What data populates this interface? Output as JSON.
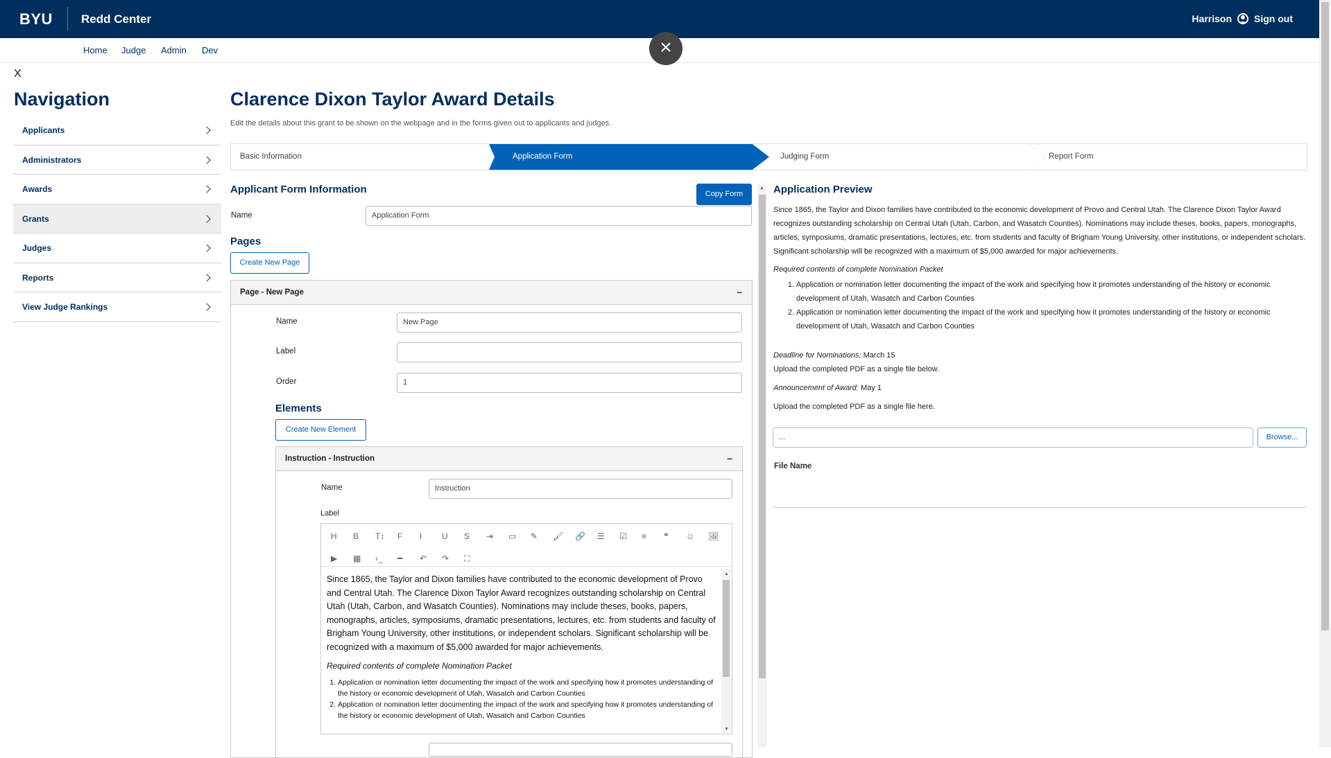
{
  "header": {
    "logo": "BYU",
    "site": "Redd Center",
    "user": "Harrison",
    "signout": "Sign out"
  },
  "subnav": [
    "Home",
    "Judge",
    "Admin",
    "Dev"
  ],
  "overlay_close": "×",
  "sidebar": {
    "close": "X",
    "title": "Navigation",
    "items": [
      "Applicants",
      "Administrators",
      "Awards",
      "Grants",
      "Judges",
      "Reports",
      "View Judge Rankings"
    ]
  },
  "page": {
    "title": "Clarence Dixon Taylor Award Details",
    "subtitle": "Edit the details about this grant to be shown on the webpage and in the forms given out to applicants and judges."
  },
  "steps": [
    "Basic Information",
    "Application Form",
    "Judging Form",
    "Report Form"
  ],
  "form": {
    "heading": "Applicant Form Information",
    "copy_button": "Copy Form",
    "name_label": "Name",
    "name_value": "Application Form",
    "pages_heading": "Pages",
    "create_page": "Create New Page",
    "page_panel": {
      "title": "Page - New Page",
      "collapse": "–",
      "name_label": "Name",
      "name_value": "New Page",
      "label_label": "Label",
      "label_value": "",
      "order_label": "Order",
      "order_value": "1",
      "elements_heading": "Elements",
      "create_element": "Create New Element",
      "element_panel": {
        "title": "Instruction - Instruction",
        "collapse": "–",
        "name_label": "Name",
        "name_value": "Instruction",
        "label_label": "Label",
        "toolbar": [
          "H",
          "B",
          "T↕",
          "F",
          "I",
          "U",
          "S",
          "⇥",
          "▭",
          "✎",
          "🖌",
          "🔗",
          "☰",
          "☑",
          "≡",
          "❝",
          "☺",
          "🖼",
          "▶",
          "▦",
          "›_",
          "━",
          "↶",
          "↷",
          "⛶"
        ],
        "editor_text": "Since 1865, the Taylor and Dixon families have contributed to the economic development of Provo and Central Utah. The Clarence Dixon Taylor Award recognizes outstanding scholarship on Central Utah (Utah, Carbon, and Wasatch Counties). Nominations may include theses, books, papers, monographs, articles, symposiums, dramatic presentations, lectures, etc. from students and faculty of Brigham Young University, other institutions, or independent scholars. Significant scholarship will be recognized with a maximum of $5,000 awarded for major achievements.",
        "editor_req": "Required contents of complete Nomination Packet",
        "editor_list": [
          "Application or nomination letter documenting the impact of the work and specifying how it promotes understanding of the history or economic development of Utah, Wasatch and Carbon Counties",
          "Application or nomination letter documenting the impact of the work and specifying how it promotes understanding of the history or economic development of Utah, Wasatch and Carbon Counties"
        ]
      }
    }
  },
  "preview": {
    "heading": "Application Preview",
    "intro": "Since 1865, the Taylor and Dixon families have contributed to the economic development of Provo and Central Utah. The Clarence Dixon Taylor Award recognizes outstanding scholarship on Central Utah (Utah, Carbon, and Wasatch Counties). Nominations may include theses, books, papers, monographs, articles, symposiums, dramatic presentations, lectures, etc. from students and faculty of Brigham Young University, other institutions, or independent scholars. Significant scholarship will be recognized with a maximum of $5,000 awarded for major achievements.",
    "req": "Required contents of complete Nomination Packet",
    "list": [
      "Application or nomination letter documenting the impact of the work and specifying how it promotes understanding of the history or economic development of Utah, Wasatch and Carbon Counties",
      "Application or nomination letter documenting the impact of the work and specifying how it promotes understanding of the history or economic development of Utah, Wasatch and Carbon Counties"
    ],
    "deadline_label": "Deadline for Nominations:",
    "deadline_value": "March 15",
    "upload1": "Upload the completed PDF as a single file below.",
    "announce_label": "Announcement of Award:",
    "announce_value": "May 1",
    "upload2": "Upload the completed PDF as a single file here.",
    "file_placeholder": "...",
    "browse": "Browse...",
    "file_name": "File Name"
  },
  "colors": {
    "brand": "#002e5d",
    "accent": "#0062b8"
  }
}
